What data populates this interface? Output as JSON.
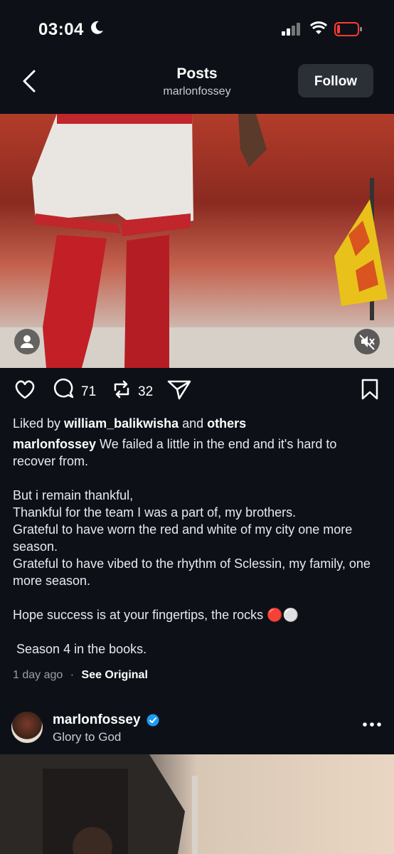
{
  "status_bar": {
    "time": "03:04"
  },
  "header": {
    "title": "Posts",
    "username": "marlonfossey",
    "follow_label": "Follow"
  },
  "post": {
    "comments_count": "71",
    "reposts_count": "32",
    "liked_prefix": "Liked by ",
    "liked_user": "william_balikwisha",
    "liked_mid": " and ",
    "liked_suffix": "others",
    "caption_user": "marlonfossey",
    "caption_text": " We failed a little in the end and it's hard to recover from.\n\nBut i remain thankful,\nThankful for the team I was a part of, my brothers.\nGrateful to have worn the red and white of my city one more season.\nGrateful to have vibed to the rhythm of Sclessin, my family, one more season.\n\nHope success is at your fingertips, the rocks 🔴⚪\n\n Season 4 in the books.",
    "time_ago": "1 day ago",
    "dot": "·",
    "see_original": "See Original"
  },
  "next_post": {
    "username": "marlonfossey",
    "caption": "Glory to God"
  },
  "colors": {
    "background": "#0d1117",
    "follow_bg": "#2b2f36",
    "verified": "#1d9bf0",
    "battery_red": "#ff3b30"
  }
}
